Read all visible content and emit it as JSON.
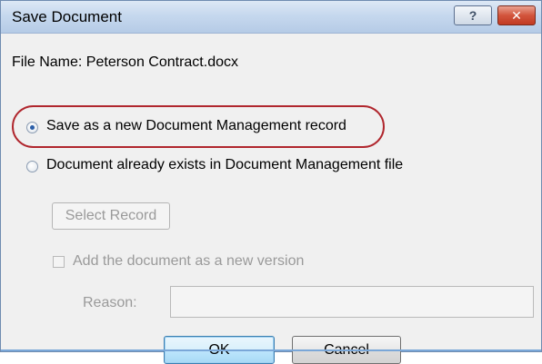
{
  "dialog": {
    "title": "Save Document",
    "help_button": "?",
    "close_button": "✕"
  },
  "form": {
    "file_name_label": "File Name: Peterson Contract.docx",
    "option_new_record": "Save as a new Document Management record",
    "option_existing": "Document already exists in Document Management file",
    "select_record_button": "Select Record",
    "new_version_checkbox_label": "Add the document as a new version",
    "reason_label": "Reason:",
    "reason_value": ""
  },
  "actions": {
    "ok_label": "OK",
    "cancel_label": "Cancel"
  },
  "colors": {
    "highlight": "#b0262d",
    "title_gradient_top": "#dde8f5",
    "close_button": "#c13a22"
  }
}
